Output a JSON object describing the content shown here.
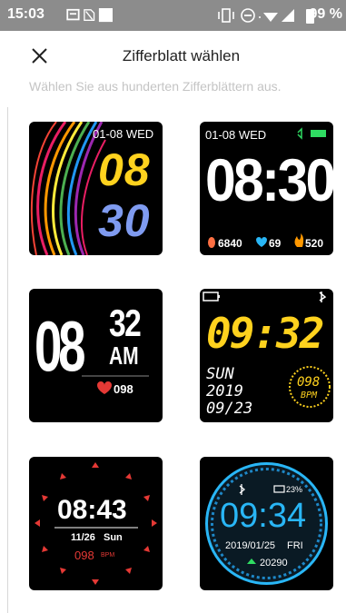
{
  "status_bar": {
    "time": "15:03",
    "battery_percent": "99 %",
    "icons": [
      "notification-icon",
      "no-sim-icon",
      "square-icon",
      "vibrate-icon",
      "dnd-icon",
      "wifi-icon",
      "signal-icon",
      "battery-icon"
    ]
  },
  "header": {
    "title": "Zifferblatt wählen",
    "close_icon": "close-icon"
  },
  "subtitle": "Wählen Sie aus hunderten Zifferblättern aus.",
  "watch_faces": [
    {
      "date": "01-08 WED",
      "hour": "08",
      "minute": "30"
    },
    {
      "date": "01-08 WED",
      "time": "08:30",
      "steps": "6840",
      "heart": "69",
      "calories": "520"
    },
    {
      "hour": "08",
      "minute": "32",
      "ampm": "AM",
      "heart": "098"
    },
    {
      "time": "09:32",
      "day": "SUN",
      "year": "2019",
      "date": "09/23",
      "bpm_value": "098",
      "bpm_label": "BPM"
    },
    {
      "time": "08:43",
      "date": "11/26",
      "day": "Sun",
      "bpm_value": "098",
      "bpm_label": "BPM"
    },
    {
      "battery": "23%",
      "time": "09:34",
      "date": "2019/01/25",
      "day": "FRI",
      "steps": "20290"
    }
  ],
  "colors": {
    "status_bar": "#8c8c8c",
    "yellow": "#ffd21e",
    "blue": "#7f9bf0",
    "green": "#2fdc62",
    "red": "#e53935",
    "cyan": "#29b6f6"
  }
}
